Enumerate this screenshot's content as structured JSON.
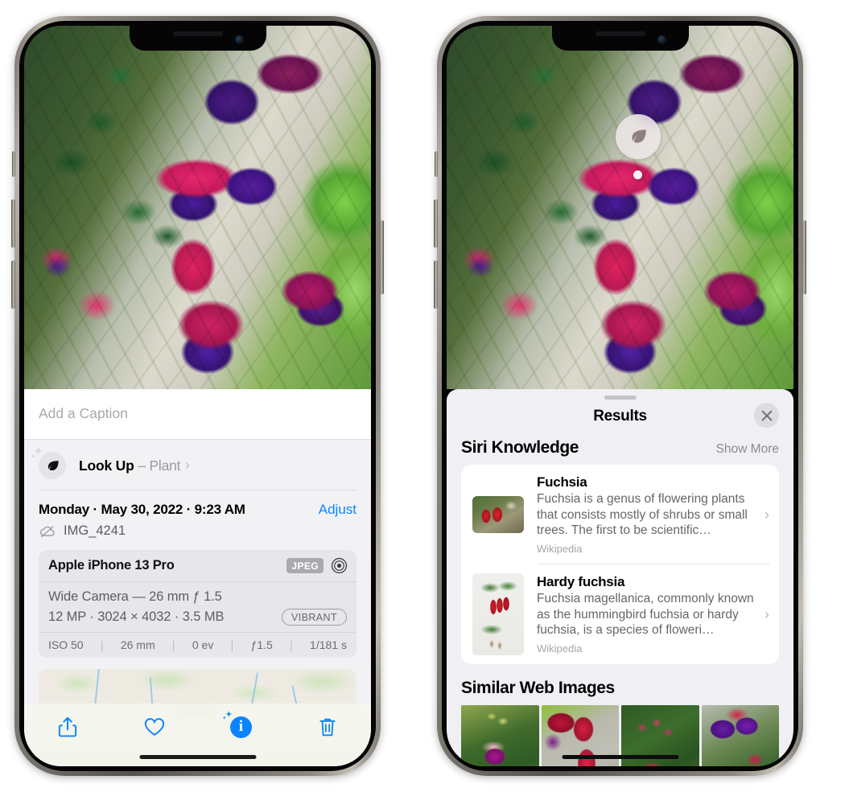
{
  "left_phone": {
    "photo": {
      "alt_name": "fuchsia-flowers-photo"
    },
    "caption": {
      "placeholder": "Add a Caption",
      "value": ""
    },
    "look_up": {
      "label": "Look Up",
      "dash": " – ",
      "subject": "Plant",
      "chevron": "›",
      "icon": "leaf-icon",
      "sparkle_icon": "sparkle-icon"
    },
    "meta": {
      "date_line": "Monday · May 30, 2022 · 9:23 AM",
      "adjust_label": "Adjust",
      "filename": "IMG_4241",
      "cloud_icon": "icloud-slash-icon"
    },
    "camera_card": {
      "model": "Apple iPhone 13 Pro",
      "format_badge": "JPEG",
      "aperture_icon": "aperture-icon",
      "lens": "Wide Camera — 26 mm ƒ 1.5",
      "size_line": "12 MP · 3024 × 4032 · 3.5 MB",
      "style_pill": "VIBRANT",
      "exif": [
        "ISO 50",
        "26 mm",
        "0 ev",
        "ƒ1.5",
        "1/181 s"
      ]
    },
    "map": {
      "name": "photo-location-map",
      "pin_name": "map-photo-pin"
    },
    "toolbar": [
      {
        "name": "share-button",
        "icon": "share-icon"
      },
      {
        "name": "favorite-button",
        "icon": "heart-icon"
      },
      {
        "name": "info-button",
        "icon": "info-sparkle-icon",
        "glyph": "i"
      },
      {
        "name": "delete-button",
        "icon": "trash-icon"
      }
    ]
  },
  "right_phone": {
    "visual_lookup_badge": {
      "icon": "leaf-icon",
      "name": "visual-lookup-badge"
    },
    "results": {
      "title": "Results",
      "close_label": "✕",
      "sections": [
        {
          "title": "Siri Knowledge",
          "action": "Show More",
          "items": [
            {
              "title": "Fuchsia",
              "description": "Fuchsia is a genus of flowering plants that consists mostly of shrubs or small trees. The first to be scientific…",
              "source": "Wikipedia",
              "chevron": "›",
              "thumb": "fuchsia-red-flowers-thumbnail"
            },
            {
              "title": "Hardy fuchsia",
              "description": "Fuchsia magellanica, commonly known as the hummingbird fuchsia or hardy fuchsia, is a species of floweri…",
              "source": "Wikipedia",
              "chevron": "›",
              "thumb": "hardy-fuchsia-specimen-thumbnail"
            }
          ]
        },
        {
          "title": "Similar Web Images",
          "images": [
            {
              "name": "similar-web-image-1"
            },
            {
              "name": "similar-web-image-2"
            },
            {
              "name": "similar-web-image-3"
            },
            {
              "name": "similar-web-image-4"
            }
          ]
        }
      ]
    }
  },
  "colors": {
    "accent_blue": "#0a84ff",
    "sheet_bg": "#f2f2f5",
    "results_bg": "#f0f0f4",
    "card_bg": "#ffffff",
    "secondary_text": "#66666c",
    "tertiary_text": "#a6a6ac"
  }
}
